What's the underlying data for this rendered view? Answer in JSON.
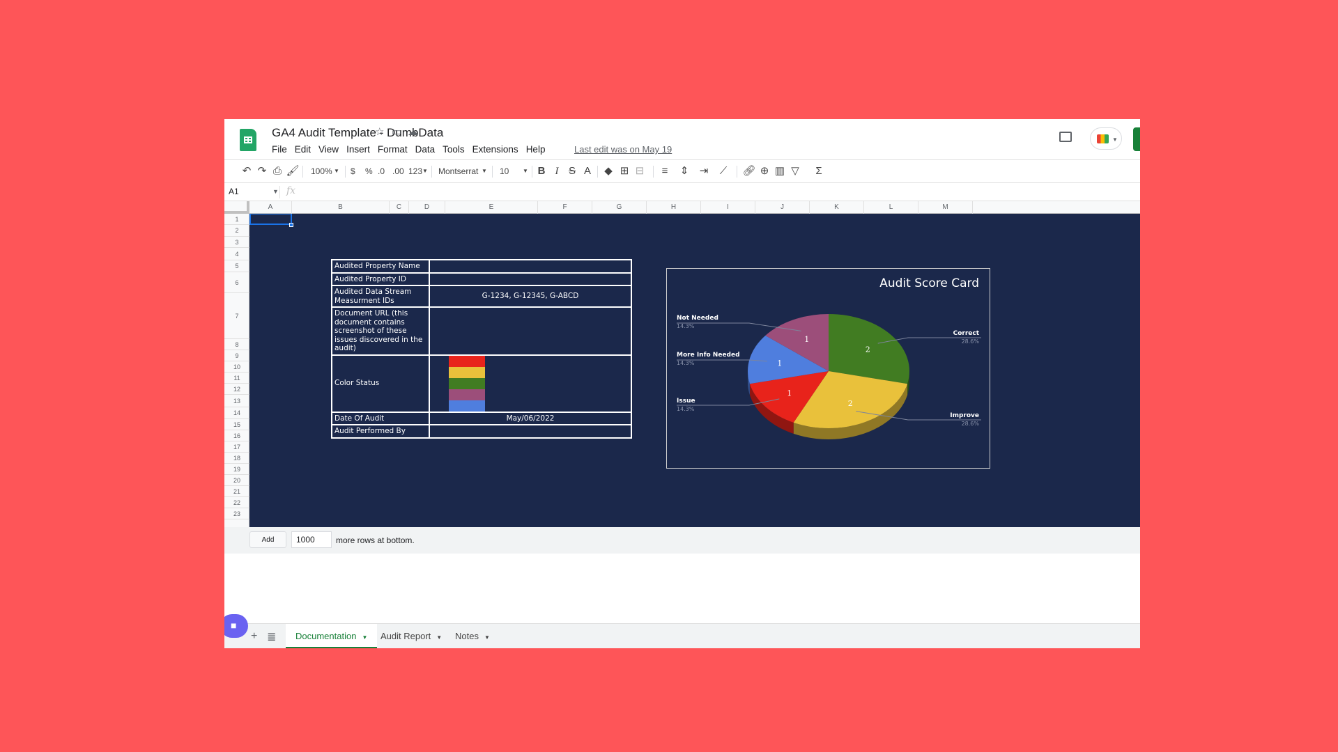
{
  "app": {
    "doc_title": "GA4 Audit Template - DumbData",
    "menu": [
      "File",
      "Edit",
      "View",
      "Insert",
      "Format",
      "Data",
      "Tools",
      "Extensions",
      "Help"
    ],
    "last_edit": "Last edit was on May 19"
  },
  "toolbar": {
    "zoom": "100%",
    "currency": "$",
    "percent": "%",
    "dec_decrease": ".0",
    "dec_increase": ".00",
    "more_formats": "123",
    "font": "Montserrat",
    "font_size": "10"
  },
  "formula_bar": {
    "cell_ref": "A1",
    "fx": "fx"
  },
  "columns": [
    "A",
    "B",
    "C",
    "D",
    "E",
    "F",
    "G",
    "H",
    "I",
    "J",
    "K",
    "L",
    "M"
  ],
  "rows": [
    "1",
    "2",
    "3",
    "4",
    "5",
    "6",
    "7",
    "8",
    "9",
    "10",
    "11",
    "12",
    "13",
    "14",
    "15",
    "16",
    "17",
    "18",
    "19",
    "20",
    "21",
    "22",
    "23"
  ],
  "audit_table": {
    "property_name_label": "Audited Property Name",
    "property_name_value": "",
    "property_id_label": "Audited Property ID",
    "property_id_value": "",
    "stream_label": "Audited Data Stream Measurment IDs",
    "stream_value": "G-1234, G-12345, G-ABCD",
    "doc_url_label": "Document URL (this document contains screenshot of these issues discovered in the audit)",
    "doc_url_value": "",
    "color_status_label": "Color Status",
    "color_status_swatches": [
      "#E8231B",
      "#E9C13B",
      "#417C22",
      "#9C4E7A",
      "#4F7EDE"
    ],
    "date_label": "Date Of Audit",
    "date_value": "May/06/2022",
    "performed_by_label": "Audit Performed By",
    "performed_by_value": ""
  },
  "chart_data": {
    "type": "pie",
    "title": "Audit Score Card",
    "categories": [
      "Correct",
      "Improve",
      "Issue",
      "More Info Needed",
      "Not Needed"
    ],
    "values": [
      2,
      2,
      1,
      1,
      1
    ],
    "percents": [
      "28.6%",
      "28.6%",
      "14.3%",
      "14.3%",
      "14.3%"
    ],
    "colors": [
      "#417C22",
      "#E9C13B",
      "#E8231B",
      "#4F7EDE",
      "#9C4E7A"
    ],
    "legend": "labels"
  },
  "add_rows": {
    "button": "Add",
    "count": "1000",
    "suffix": "more rows at bottom."
  },
  "sheet_tabs": [
    "Documentation",
    "Audit Report",
    "Notes"
  ]
}
